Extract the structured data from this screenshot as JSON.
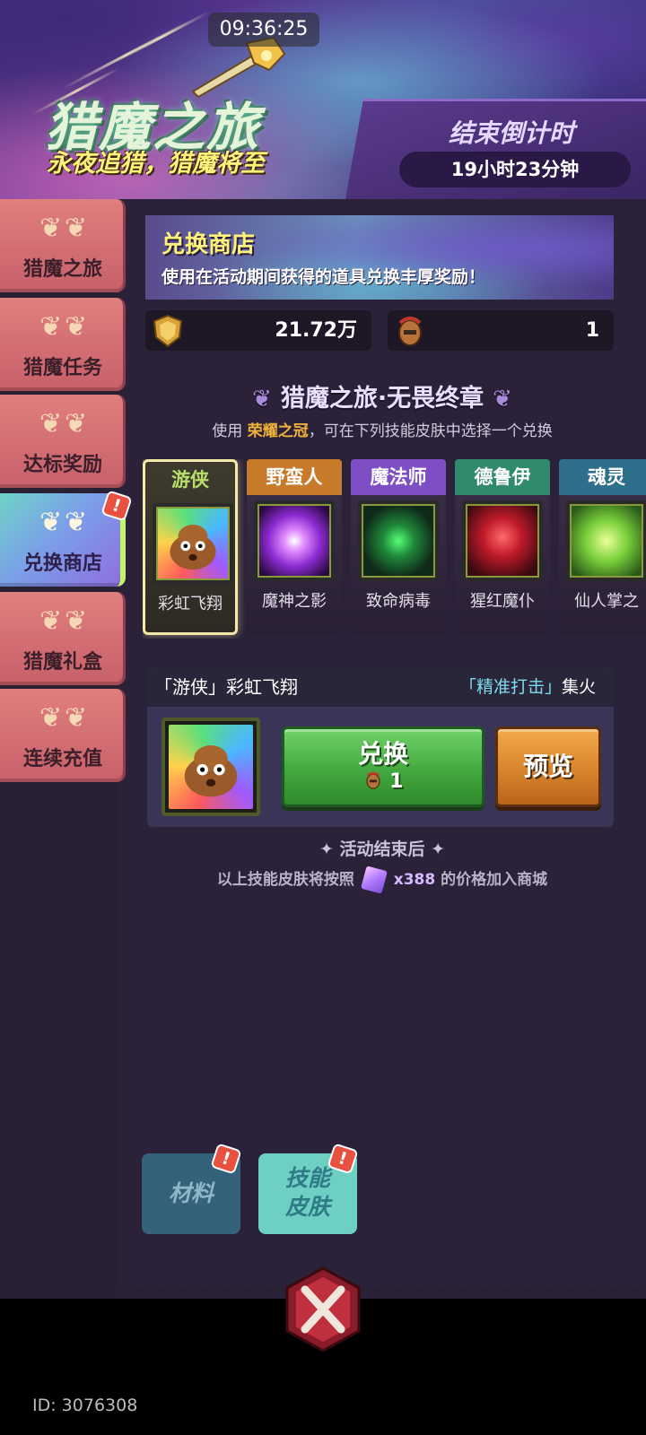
{
  "status": {
    "time": "09:36:25"
  },
  "header": {
    "title": "猎魔之旅",
    "subtitle": "永夜追猎，猎魔将至",
    "countdown_title": "结束倒计时",
    "countdown_value": "19小时23分钟"
  },
  "sidebar": {
    "items": [
      {
        "label": "猎魔之旅"
      },
      {
        "label": "猎魔任务"
      },
      {
        "label": "达标奖励"
      },
      {
        "label": "兑换商店",
        "badge": "!"
      },
      {
        "label": "猎魔礼盒"
      },
      {
        "label": "连续充值"
      }
    ]
  },
  "shop": {
    "title": "兑换商店",
    "description": "使用在活动期间获得的道具兑换丰厚奖励！",
    "currency_gold": "21.72万",
    "currency_crown": "1"
  },
  "section": {
    "title": "猎魔之旅·无畏终章",
    "sub_before": "使用",
    "sub_highlight": "荣耀之冠",
    "sub_after": "，可在下列技能皮肤中选择一个兑换"
  },
  "skins": [
    {
      "class": "游侠",
      "name": "彩虹飞翔",
      "head_color": "#7aa03c"
    },
    {
      "class": "野蛮人",
      "name": "魔神之影",
      "head_color": "#c77a2a"
    },
    {
      "class": "魔法师",
      "name": "致命病毒",
      "head_color": "#7d4ec4"
    },
    {
      "class": "德鲁伊",
      "name": "猩红魔仆",
      "head_color": "#2f8a6e"
    },
    {
      "class": "魂灵",
      "name": "仙人掌之",
      "head_color": "#2e6f8c"
    }
  ],
  "detail": {
    "left_text": "「游侠」彩虹飞翔",
    "right_text_blue": "「精准打击」",
    "right_text_white": "集火",
    "exchange_label": "兑换",
    "exchange_cost": "1",
    "preview_label": "预览"
  },
  "notes": {
    "line1": "✦ 活动结束后 ✦",
    "line2_before": "以上技能皮肤将按照",
    "price": "x388",
    "line2_after": "的价格加入商城"
  },
  "tabs": {
    "material": "材料",
    "skin_line1": "技能",
    "skin_line2": "皮肤"
  },
  "footer": {
    "user_id": "ID: 3076308"
  }
}
